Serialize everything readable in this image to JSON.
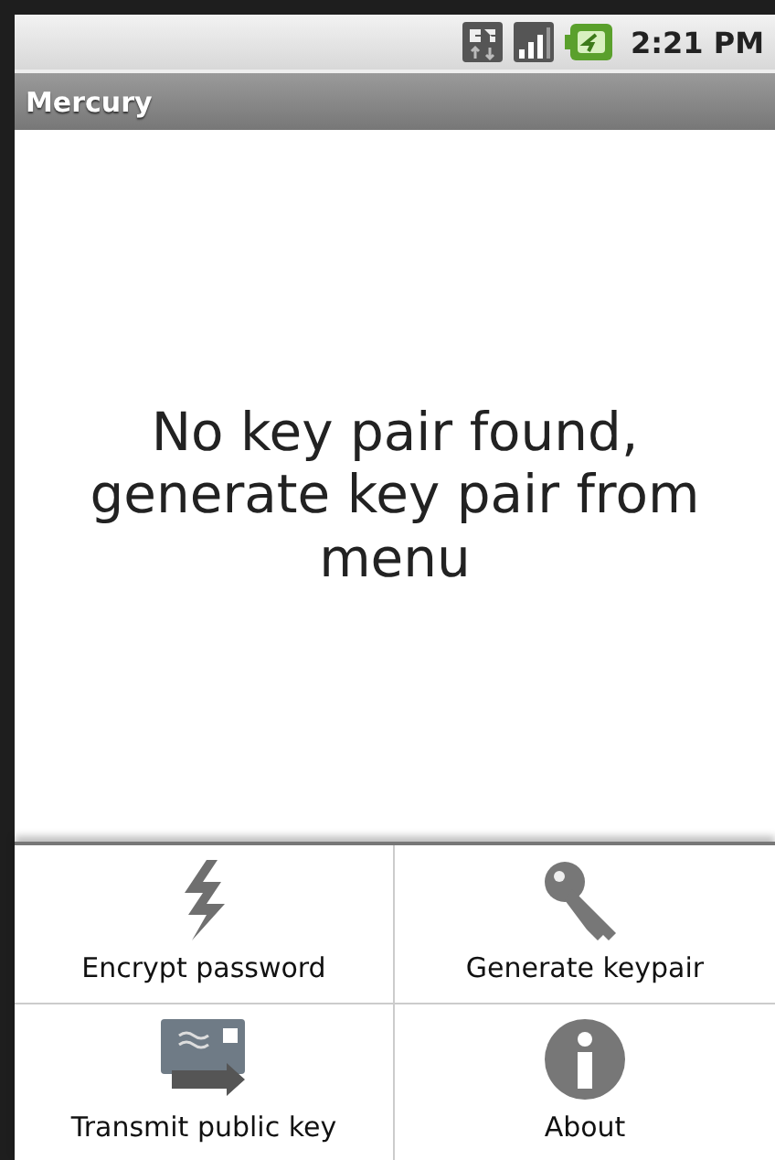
{
  "status_bar": {
    "time": "2:21 PM"
  },
  "title_bar": {
    "title": "Mercury"
  },
  "message": "No key pair found, generate key pair from menu",
  "options_menu": [
    {
      "label": "Encrypt password"
    },
    {
      "label": "Generate keypair"
    },
    {
      "label": "Transmit public key"
    },
    {
      "label": "About"
    }
  ]
}
